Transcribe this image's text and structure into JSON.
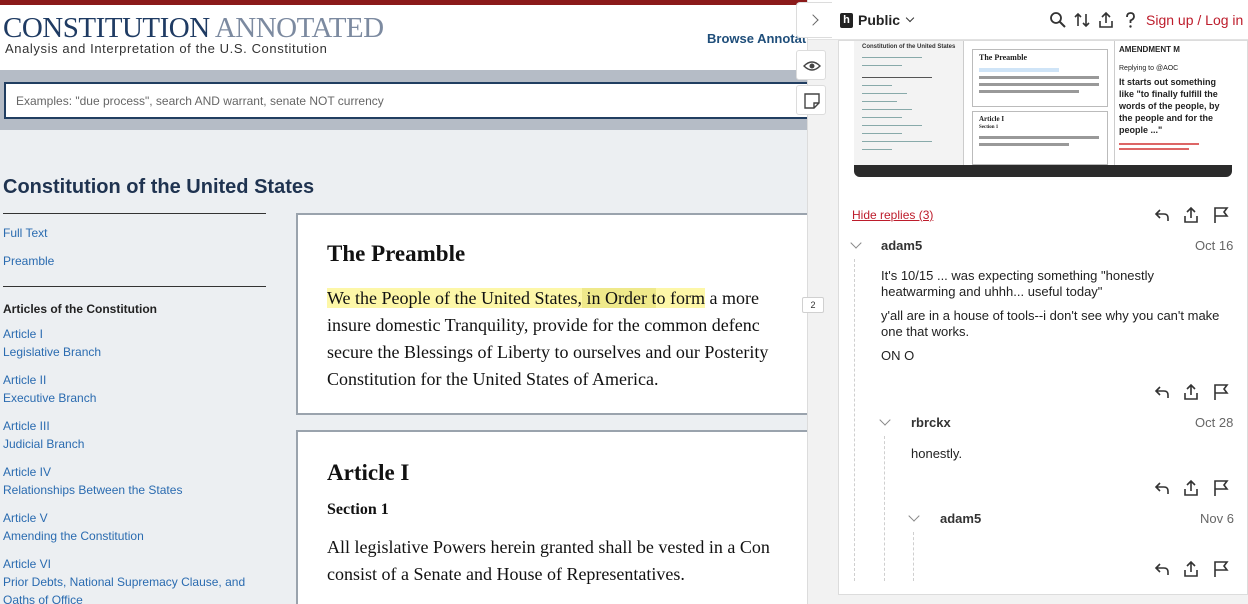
{
  "site": {
    "title_main": "CONSTITUTION",
    "title_light": "ANNOTATED",
    "subtitle": "Analysis and Interpretation of the U.S. Constitution",
    "browse_label": "Browse Annotat..."
  },
  "search": {
    "placeholder": "Examples: \"due process\", search AND warrant, senate NOT currency"
  },
  "toc": {
    "heading": "Constitution of the United States",
    "links_top": [
      "Full Text",
      "Preamble"
    ],
    "articles_heading": "Articles of the Constitution",
    "articles": [
      {
        "name": "Article I",
        "desc": "Legislative Branch"
      },
      {
        "name": "Article II",
        "desc": "Executive Branch"
      },
      {
        "name": "Article III",
        "desc": "Judicial Branch"
      },
      {
        "name": "Article IV",
        "desc": "Relationships Between the States"
      },
      {
        "name": "Article V",
        "desc": "Amending the Constitution"
      },
      {
        "name": "Article VI",
        "desc": "Prior Debts, National Supremacy Clause, and",
        "desc2": "Oaths of Office"
      }
    ]
  },
  "preamble": {
    "title": "The Preamble",
    "line1_hl": "We the People of the United States,",
    "line1_hl2": " in Order t",
    "line1_hl3": "o form",
    "line1_rest": " a more",
    "line2": "insure domestic Tranquility, provide for the common defenc",
    "line3": "secure the Blessings of Liberty to ourselves and our Posterity",
    "line4": "Constitution for the United States of America."
  },
  "article1": {
    "title": "Article I",
    "section": "Section 1",
    "line1": "All legislative Powers herein granted shall be vested in a Con",
    "line2": "consist of a Senate and House of Representatives."
  },
  "sidebar": {
    "public_label": "Public",
    "signup": "Sign up",
    "separator": " / ",
    "login": "Log in",
    "highlight_count": "2",
    "hide_replies": "Hide replies (3)",
    "thumbnail": {
      "toc_title": "Constitution of the United States",
      "preamble": "The Preamble",
      "article": "Article I",
      "section": "Section 1",
      "ann_title": "AMENDMENT M",
      "ann_reply": "Replying to @AOC",
      "ann_quote_1": "It starts out something",
      "ann_quote_2": "like \"to finally fulfill the",
      "ann_quote_3": "words of the people, by",
      "ann_quote_4": "the people and for the",
      "ann_quote_5": "people ...\""
    },
    "replies": [
      {
        "user": "adam5",
        "date": "Oct 16",
        "paragraphs": [
          "It's 10/15 ... was expecting something \"honestly heatwarming and uhhh... useful today\"",
          "y'all are in a house of tools--i don't see why you can't make one that works.",
          "ON O"
        ]
      },
      {
        "user": "rbrckx",
        "date": "Oct 28",
        "paragraphs": [
          "honestly."
        ]
      },
      {
        "user": "adam5",
        "date": "Nov 6",
        "paragraphs": []
      }
    ]
  }
}
